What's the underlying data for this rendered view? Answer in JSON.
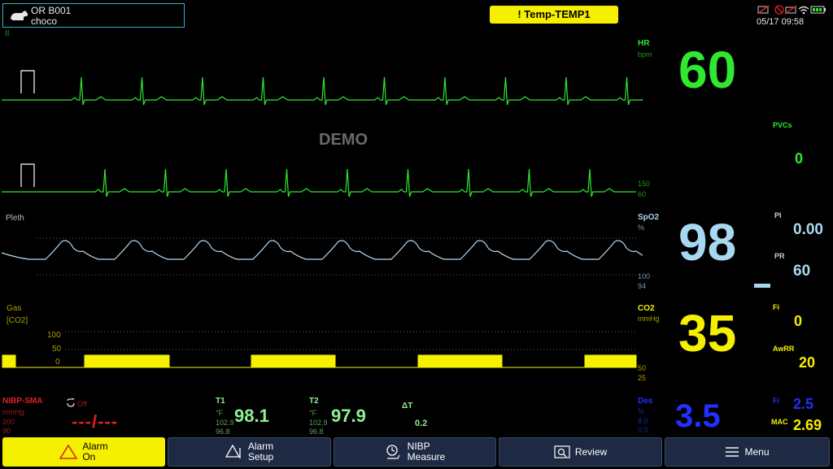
{
  "header": {
    "room": "OR B001",
    "patient": "choco",
    "alarm_banner": "! Temp-TEMP1",
    "datetime": "05/17 09:58"
  },
  "ecg": {
    "lead": "II",
    "demo": "DEMO",
    "hr_label": "HR",
    "hr_unit": "bpm",
    "hr_value": "60",
    "hr_upper": "150",
    "hr_lower": "60",
    "pvcs_label": "PVCs",
    "pvcs_value": "0"
  },
  "spo2": {
    "wave_label": "Pleth",
    "label": "SpO2",
    "unit": "%",
    "value": "98",
    "upper": "100",
    "lower": "94",
    "pi_label": "PI",
    "pi_value": "0.00",
    "pr_label": "PR",
    "pr_value": "60"
  },
  "gas": {
    "wave_label": "Gas",
    "wave_sub": "[CO2]",
    "scale": [
      "100",
      "50",
      "0"
    ],
    "label": "CO2",
    "unit": "mmHg",
    "value": "35",
    "upper": "50",
    "lower": "25",
    "fi_label": "Fi",
    "fi_value": "0",
    "awrr_label": "AwRR",
    "awrr_value": "20"
  },
  "nibp": {
    "label": "NIBP-SMA",
    "unit": "mmHg",
    "upper": "200",
    "lower": "90",
    "mode": "Off",
    "value": "---/---"
  },
  "temp": {
    "t1_label": "T1",
    "t1_unit": "°F",
    "t1_upper": "102.9",
    "t1_lower": "96.8",
    "t1_value": "98.1",
    "t2_label": "T2",
    "t2_unit": "°F",
    "t2_upper": "102.9",
    "t2_lower": "96.8",
    "t2_value": "97.9",
    "dt_label": "ΔT",
    "dt_value": "0.2"
  },
  "des": {
    "label": "Des",
    "unit": "%",
    "upper": "8.0",
    "lower": "0.0",
    "value": "3.5",
    "fi_label": "Fi",
    "fi_value": "2.5",
    "mac_label": "MAC",
    "mac_value": "2.69"
  },
  "bottom": {
    "alarm_on_1": "Alarm",
    "alarm_on_2": "On",
    "alarm_setup_1": "Alarm",
    "alarm_setup_2": "Setup",
    "nibp_measure_1": "NIBP",
    "nibp_measure_2": "Measure",
    "review": "Review",
    "menu": "Menu"
  },
  "colors": {
    "ecg": "#2fe82f",
    "spo2": "#a8d8f0",
    "co2": "#f5f000",
    "des": "#2030ff",
    "nibp": "#e02020",
    "temp": "#90f090",
    "alarm": "#f5f000"
  }
}
